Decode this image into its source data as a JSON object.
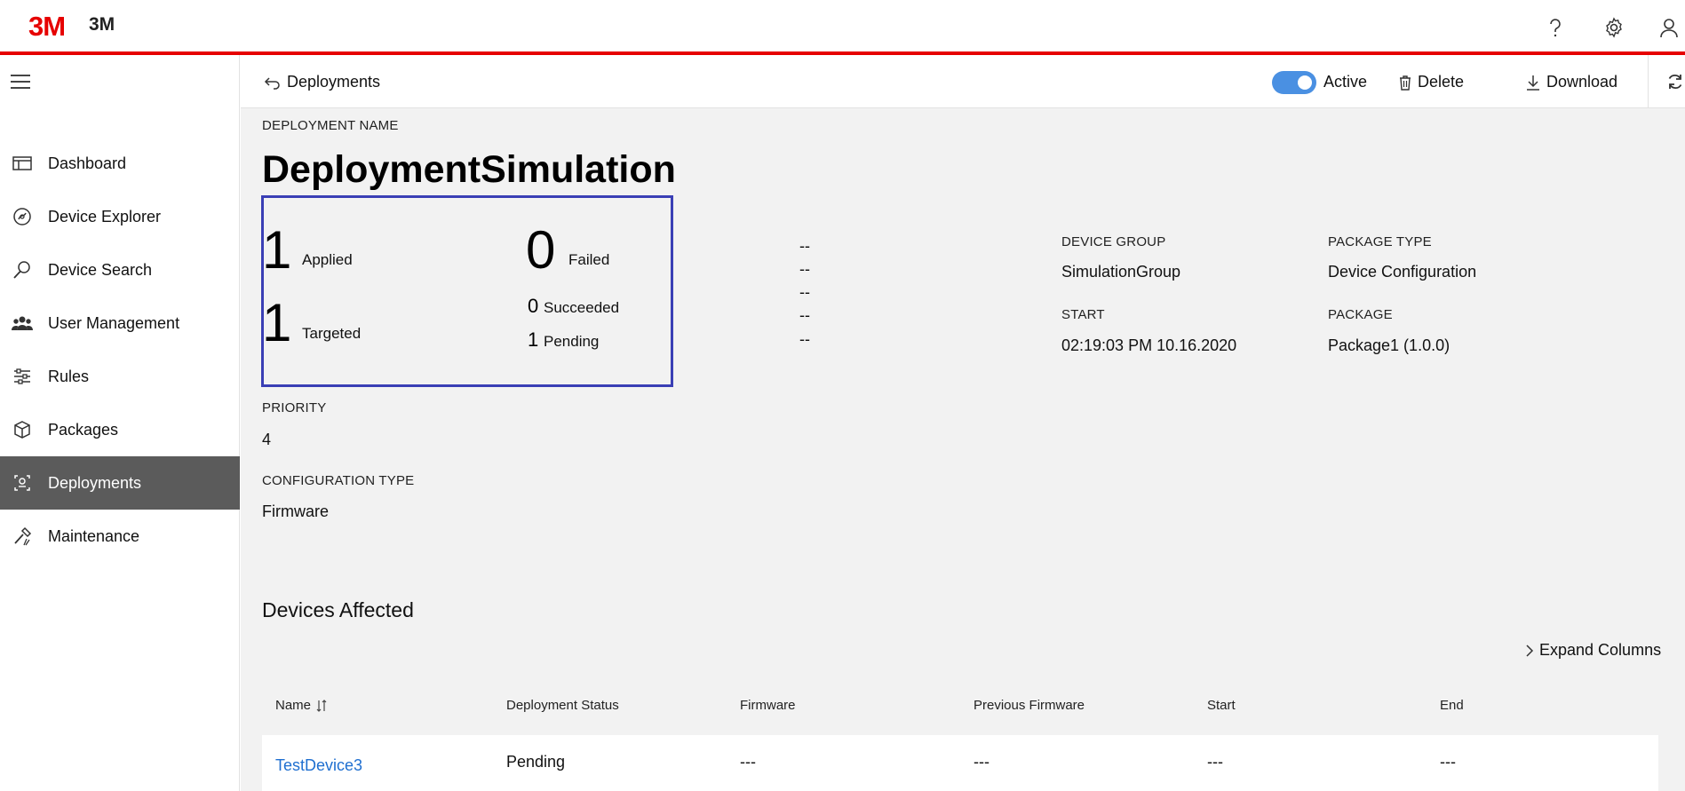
{
  "header": {
    "logo_mark": "3M",
    "logo_text": "3M",
    "icons": [
      "help-icon",
      "settings-gear-icon",
      "user-profile-icon"
    ]
  },
  "sidebar": {
    "items": [
      {
        "label": "Dashboard",
        "icon": "dashboard-icon"
      },
      {
        "label": "Device Explorer",
        "icon": "device-explorer-icon"
      },
      {
        "label": "Device Search",
        "icon": "search-icon"
      },
      {
        "label": "User Management",
        "icon": "users-icon"
      },
      {
        "label": "Rules",
        "icon": "rules-icon"
      },
      {
        "label": "Packages",
        "icon": "package-icon"
      },
      {
        "label": "Deployments",
        "icon": "deployments-icon",
        "active": true
      },
      {
        "label": "Maintenance",
        "icon": "maintenance-icon"
      }
    ]
  },
  "toolbar": {
    "back_label": "Deployments",
    "active_label": "Active",
    "active_on": true,
    "delete_label": "Delete",
    "download_label": "Download"
  },
  "deployment": {
    "name_caption": "DEPLOYMENT NAME",
    "name": "DeploymentSimulation",
    "stats": {
      "applied_count": "1",
      "applied_label": "Applied",
      "targeted_count": "1",
      "targeted_label": "Targeted",
      "failed_count": "0",
      "failed_label": "Failed",
      "succeeded_count": "0",
      "succeeded_label": "Succeeded",
      "pending_count": "1",
      "pending_label": "Pending"
    },
    "dashes": [
      "--",
      "--",
      "--",
      "--",
      "--"
    ],
    "device_group_caption": "DEVICE GROUP",
    "device_group": "SimulationGroup",
    "start_caption": "START",
    "start": "02:19:03 PM 10.16.2020",
    "package_type_caption": "PACKAGE TYPE",
    "package_type": "Device Configuration",
    "package_caption": "PACKAGE",
    "package": "Package1 (1.0.0)",
    "priority_caption": "PRIORITY",
    "priority": "4",
    "config_type_caption": "CONFIGURATION TYPE",
    "config_type": "Firmware"
  },
  "devices": {
    "title": "Devices Affected",
    "expand_label": "Expand Columns",
    "columns": [
      "Name",
      "Deployment Status",
      "Firmware",
      "Previous Firmware",
      "Start",
      "End"
    ],
    "rows": [
      {
        "name": "TestDevice3",
        "status": "Pending",
        "firmware": "---",
        "previous_firmware": "---",
        "start": "---",
        "end": "---"
      }
    ]
  }
}
